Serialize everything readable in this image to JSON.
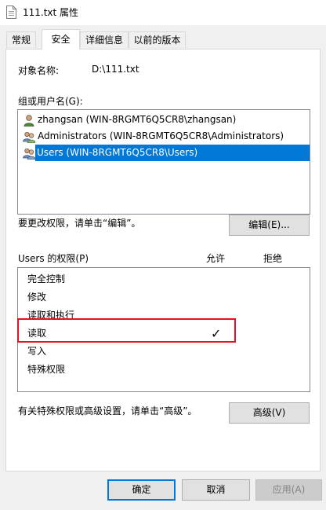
{
  "window": {
    "title": "111.txt 属性"
  },
  "tabs": [
    {
      "label": "常规"
    },
    {
      "label": "安全"
    },
    {
      "label": "详细信息"
    },
    {
      "label": "以前的版本"
    }
  ],
  "object": {
    "label": "对象名称:",
    "value": "D:\\111.txt"
  },
  "groups": {
    "label": "组或用户名(G):",
    "items": [
      {
        "name": "zhangsan (WIN-8RGMT6Q5CR8\\zhangsan)",
        "icon": "user-icon"
      },
      {
        "name": "Administrators (WIN-8RGMT6Q5CR8\\Administrators)",
        "icon": "group-icon"
      },
      {
        "name": "Users (WIN-8RGMT6Q5CR8\\Users)",
        "icon": "group-icon",
        "selected": true
      }
    ]
  },
  "edit": {
    "hint": "要更改权限，请单击“编辑”。",
    "button": "编辑(E)..."
  },
  "permissions": {
    "label": "Users 的权限(P)",
    "allow_header": "允许",
    "deny_header": "拒绝",
    "items": [
      {
        "name": "完全控制",
        "allow": false,
        "deny": false
      },
      {
        "name": "修改",
        "allow": false,
        "deny": false
      },
      {
        "name": "读取和执行",
        "allow": false,
        "deny": false
      },
      {
        "name": "读取",
        "allow": true,
        "deny": false
      },
      {
        "name": "写入",
        "allow": false,
        "deny": false
      },
      {
        "name": "特殊权限",
        "allow": false,
        "deny": false
      }
    ],
    "check_glyph": "✓"
  },
  "advanced": {
    "hint": "有关特殊权限或高级设置，请单击“高级”。",
    "button": "高级(V)"
  },
  "footer": {
    "ok": "确定",
    "cancel": "取消",
    "apply": "应用(A)"
  },
  "colors": {
    "selection": "#0078d7",
    "highlight": "#e81123"
  }
}
